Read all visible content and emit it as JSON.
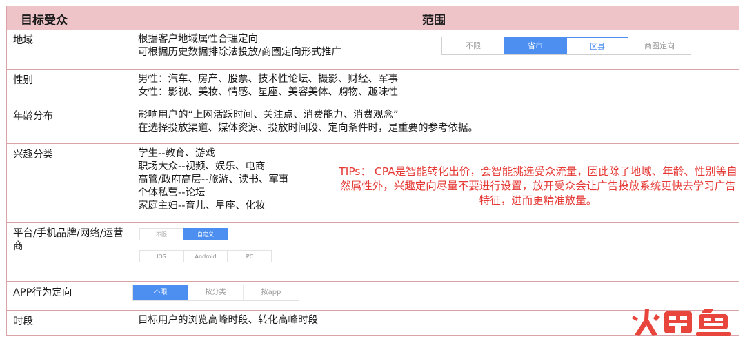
{
  "header": {
    "col1": "目标受众",
    "col2": "范围"
  },
  "rows": {
    "region": {
      "label": "地域",
      "lines": [
        "根据客户地域属性合理定向",
        "可根据历史数据排除法投放/商圈定向形式推广"
      ],
      "options": [
        "不限",
        "省市",
        "区县",
        "商圈定向"
      ],
      "selected": "省市"
    },
    "gender": {
      "label": "性别",
      "lines": [
        "男性：汽车、房产、股票、技术性论坛、摄影、财经、军事",
        "女性：影视、美妆、情感、星座、美容美体、购物、趣味性"
      ]
    },
    "age": {
      "label": "年龄分布",
      "lines": [
        "影响用户的“上网活跃时间、关注点、消费能力、消费观念”",
        "在选择投放渠道、媒体资源、投放时间段、定向条件时，是重要的参考依据。"
      ]
    },
    "interest": {
      "label": "兴趣分类",
      "lines": [
        "学生--教育、游戏",
        "职场大众--视频、娱乐、电商",
        "高管/政府高层--旅游、读书、军事",
        "个体私营--论坛",
        "家庭主妇--育儿、星座、化妆"
      ],
      "tips": "TIPs： CPA是智能转化出价，会智能挑选受众流量，因此除了地域、年龄、性别等自然属性外，兴趣定向尽量不要进行设置，放开受众会让广告投放系统更快去学习广告特征，进而更精准放量。"
    },
    "platform": {
      "label": "平台/手机品牌/网络/运营商",
      "options_top": [
        "不限",
        "自定义"
      ],
      "selected_top": "自定义",
      "options_bottom": [
        "IOS",
        "Android",
        "PC"
      ]
    },
    "app": {
      "label": "APP行为定向",
      "options": [
        "不限",
        "按分类",
        "按app"
      ],
      "selected": "不限"
    },
    "time": {
      "label": "时段",
      "lines": [
        "目标用户的浏览高峰时段、转化高峰时段"
      ]
    }
  },
  "watermark": {
    "text": "火鲤鱼"
  },
  "colors": {
    "header_bg": "#efc4c8",
    "border": "#d9a3a8",
    "tips": "#e53935",
    "accent": "#4c8ff0"
  }
}
